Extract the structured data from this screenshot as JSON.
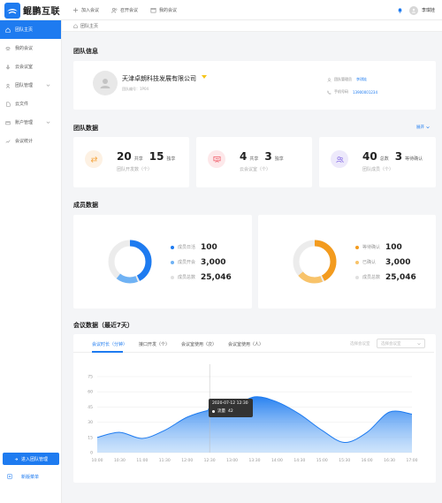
{
  "app": {
    "logo_text": "鲲鹏互联"
  },
  "top_nav": [
    {
      "label": "加入会议"
    },
    {
      "label": "召开会议"
    },
    {
      "label": "我的会议"
    }
  ],
  "user": {
    "name": "李琪娃"
  },
  "sidebar": {
    "items": [
      {
        "label": "团队主页",
        "active": true
      },
      {
        "label": "我的会议"
      },
      {
        "label": "云会议室"
      },
      {
        "label": "团队管理",
        "has_children": true
      },
      {
        "label": "云文件"
      },
      {
        "label": "账户管理",
        "has_children": true
      },
      {
        "label": "会议统计"
      }
    ],
    "enter_button": "进入团队管理",
    "new_menu": "新版菜单"
  },
  "breadcrumb": {
    "label": "团队主页"
  },
  "team_info": {
    "section_title": "团队信息",
    "name": "天津卓朗科技发展有限公司",
    "team_no": "团队编号：1P04",
    "admin_label": "团队管理员",
    "admin_value": "李琪娃",
    "phone_label": "手机号码",
    "phone_value": "13900001234"
  },
  "team_data": {
    "section_title": "团队数据",
    "expand": "展开",
    "cards": [
      {
        "v1": "20",
        "u1": "共享",
        "v2": "15",
        "u2": "独享",
        "sub": "团队开发数（个）",
        "icon": "swap-icon",
        "bg": "#fdf1e3",
        "fg": "#f5a33c"
      },
      {
        "v1": "4",
        "u1": "共享",
        "v2": "3",
        "u2": "独享",
        "sub": "云会议室（个）",
        "icon": "presentation-icon",
        "bg": "#fde8ea",
        "fg": "#ef5361"
      },
      {
        "v1": "40",
        "u1": "总数",
        "v2": "3",
        "u2": "等待确认",
        "sub": "团队成员（个）",
        "icon": "users-icon",
        "bg": "#ede9fb",
        "fg": "#8b72e6"
      }
    ]
  },
  "member_data": {
    "section_title": "成员数据",
    "left": {
      "rows": [
        {
          "label": "成员日活",
          "value": "100",
          "color": "#1e7bf0"
        },
        {
          "label": "成员开会",
          "value": "3,000",
          "color": "#6fb2f4"
        },
        {
          "label": "成员总数",
          "value": "25,046",
          "color": "#e0e0e0"
        }
      ]
    },
    "right": {
      "rows": [
        {
          "label": "等待确认",
          "value": "100",
          "color": "#f39b1e"
        },
        {
          "label": "已确认",
          "value": "3,000",
          "color": "#f8c36a"
        },
        {
          "label": "成员总数",
          "value": "25,046",
          "color": "#e0e0e0"
        }
      ]
    }
  },
  "meeting_data": {
    "section_title": "会议数据（最近7天）",
    "tabs": [
      "会议时长（分钟）",
      "接口开发（个）",
      "会议室使用（次）",
      "会议室使用（人）"
    ],
    "room_label": "选择会议室",
    "room_placeholder": "选择会议室",
    "tooltip_time": "2020-07-12 12:30",
    "tooltip_label": "流量",
    "tooltip_value": "42"
  },
  "chart_data": {
    "type": "area",
    "x": [
      "10:00",
      "10:30",
      "11:00",
      "11:30",
      "12:00",
      "12:30",
      "13:00",
      "13:30",
      "14:00",
      "14:30",
      "15:00",
      "15:30",
      "16:00",
      "16:30",
      "17:00"
    ],
    "values": [
      15,
      20,
      14,
      22,
      35,
      42,
      45,
      55,
      50,
      38,
      22,
      10,
      20,
      40,
      38
    ],
    "ylim": [
      0,
      75
    ],
    "yticks": [
      0,
      15,
      30,
      45,
      60,
      75
    ],
    "color": "#1e7bf0",
    "grid": "horizontal",
    "highlight_index": 5
  }
}
